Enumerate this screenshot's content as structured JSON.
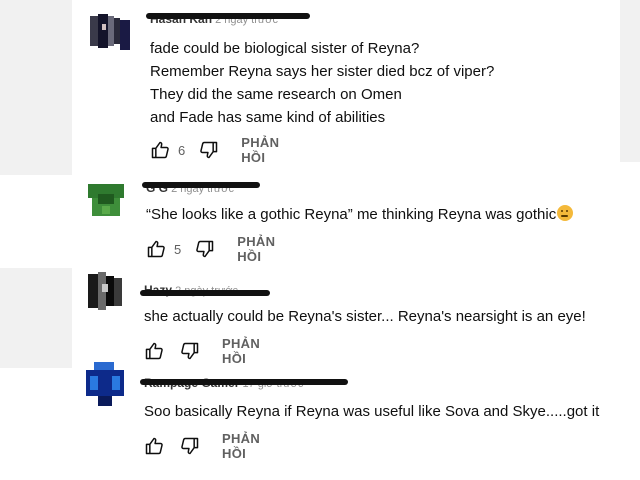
{
  "comments": [
    {
      "author": "Hasan Kan",
      "time": "2 ngày trước",
      "lines": [
        "fade could be biological sister of Reyna?",
        "Remember Reyna says her sister died bcz of viper?",
        "They did the same research on Omen",
        "and Fade has same kind of abilities"
      ],
      "likes": "6",
      "reply_label": "PHẢN HỒI"
    },
    {
      "author": "G G",
      "time": "2 ngày trước",
      "lines": [
        "“She looks like a gothic Reyna” me thinking Reyna was gothic"
      ],
      "emoji": "thinking-face",
      "likes": "5",
      "reply_label": "PHẢN HỒI"
    },
    {
      "author": "Hazy",
      "time": "2 ngày trước",
      "lines": [
        "she actually could be Reyna's sister... Reyna's nearsight is an eye!"
      ],
      "likes": "",
      "reply_label": "PHẢN HỒI"
    },
    {
      "author": "Rampage Gamer",
      "time": "17 giờ trước",
      "lines": [
        "Soo basically Reyna if Reyna was useful like Sova and Skye.....got it"
      ],
      "likes": "",
      "reply_label": "PHẢN HỒI"
    }
  ],
  "icons": {
    "like": "thumb-up-icon",
    "dislike": "thumb-down-icon"
  },
  "colors": {
    "page_bg": "#ffffff",
    "side_band": "#f1f1f1",
    "muted_text": "#606060",
    "redaction": "#111111"
  }
}
